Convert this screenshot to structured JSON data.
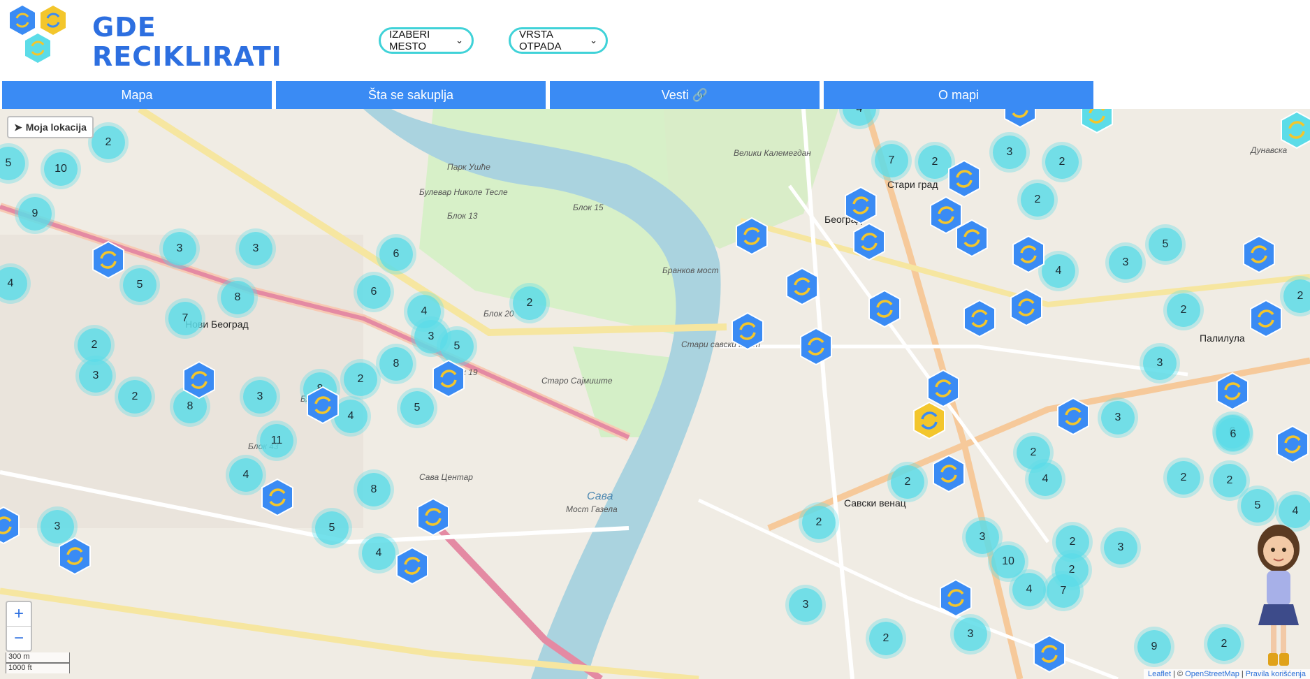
{
  "app": {
    "logo_line1": "GDE",
    "logo_line2": "RECIKLIRATI"
  },
  "filters": {
    "city": "IZABERI MESTO",
    "waste_type": "VRSTA OTPADA"
  },
  "nav": [
    {
      "label": "Mapa"
    },
    {
      "label": "Šta se sakuplja"
    },
    {
      "label": "Vesti 🔗"
    },
    {
      "label": "O mapi"
    }
  ],
  "map": {
    "my_location": "Moja lokacija",
    "zoom_in": "+",
    "zoom_out": "−",
    "scale_metric": "300 m",
    "scale_imperial": "1000 ft",
    "attribution": {
      "leaflet": "Leaflet",
      "sep1": " | © ",
      "osm": "OpenStreetMap",
      "sep2": " | ",
      "rules": "Pravila korišćenja"
    },
    "labels": {
      "park": "Парк Ушће",
      "beograd": "Београд",
      "novi_beograd": "Нови Београд",
      "stari_grad": "Стари град",
      "savski_venac": "Савски венац",
      "palilula": "Палилула",
      "blok15": "Блок 15",
      "blok13": "Блок 13",
      "blok19": "Блок 19",
      "blok20": "Блок 20",
      "blok23": "Блок 23",
      "blok43": "Блок 43",
      "sava": "Сава",
      "brankov_most": "Бранков мост",
      "stari_savski_most": "Стари савски мост",
      "most_gazela": "Мост Газела",
      "bulevar_nikole_tesle": "Булевар Николе Тесле",
      "sava_centar": "Сава Центар",
      "sajmiste": "Старо Сајмиште",
      "dunavska": "Дунавска",
      "kalemegdan": "Велики Калемегдан"
    },
    "clusters": [
      "2",
      "5",
      "10",
      "9",
      "3",
      "3",
      "4",
      "5",
      "6",
      "8",
      "7",
      "2",
      "3",
      "2",
      "8",
      "6",
      "4",
      "3",
      "5",
      "8",
      "2",
      "3",
      "4",
      "5",
      "8",
      "11",
      "4",
      "3",
      "5",
      "8",
      "4",
      "2",
      "4",
      "7",
      "2",
      "3",
      "2",
      "2",
      "4",
      "5",
      "3",
      "2",
      "3",
      "6",
      "2",
      "2",
      "2",
      "3",
      "2",
      "2",
      "4",
      "10",
      "2",
      "3",
      "4",
      "7",
      "3",
      "2",
      "3",
      "2",
      "9",
      "2",
      "5",
      "3",
      "6",
      "4",
      "2"
    ]
  }
}
